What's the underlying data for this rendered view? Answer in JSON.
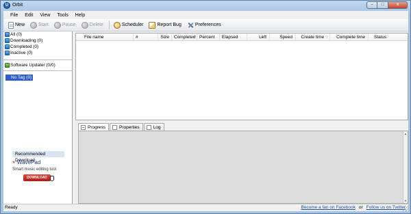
{
  "window": {
    "title": "Orbit",
    "app_icon": "U",
    "min_glyph": "–",
    "max_glyph": "□",
    "close_glyph": "x"
  },
  "menu": [
    "File",
    "Edit",
    "View",
    "Tools",
    "Help"
  ],
  "toolbar": {
    "new_label": "New",
    "start_label": "Start",
    "pause_label": "Pause",
    "delete_label": "Delete",
    "scheduler_label": "Scheduler",
    "report_bug_label": "Report Bug",
    "preferences_label": "Preferences"
  },
  "sidebar": {
    "status_items": [
      {
        "label": "All (0)"
      },
      {
        "label": "Downloading (0)"
      },
      {
        "label": "Completed (0)"
      },
      {
        "label": "Inactive (0)"
      }
    ],
    "updater_label": "Software Updater (0/0)",
    "tag_label": "No Tag (0)"
  },
  "recommended": {
    "heading": "Recommended Download",
    "product": "WavePad",
    "description": "Smart music editing tool",
    "download_label": "DOWNLOAD"
  },
  "grid": {
    "columns": [
      "File name",
      "#",
      "Size",
      "Completed",
      "Percent",
      "Elapsed",
      "Left",
      "Speed",
      "Create time",
      "Complete time",
      "Status"
    ]
  },
  "tabs": [
    {
      "label": "Progress"
    },
    {
      "label": "Properties"
    },
    {
      "label": "Log"
    }
  ],
  "statusbar": {
    "status": "Ready",
    "facebook_link": "Become a fan on Facebook",
    "or_text": "or",
    "twitter_link": "Follow us on Twitter"
  }
}
